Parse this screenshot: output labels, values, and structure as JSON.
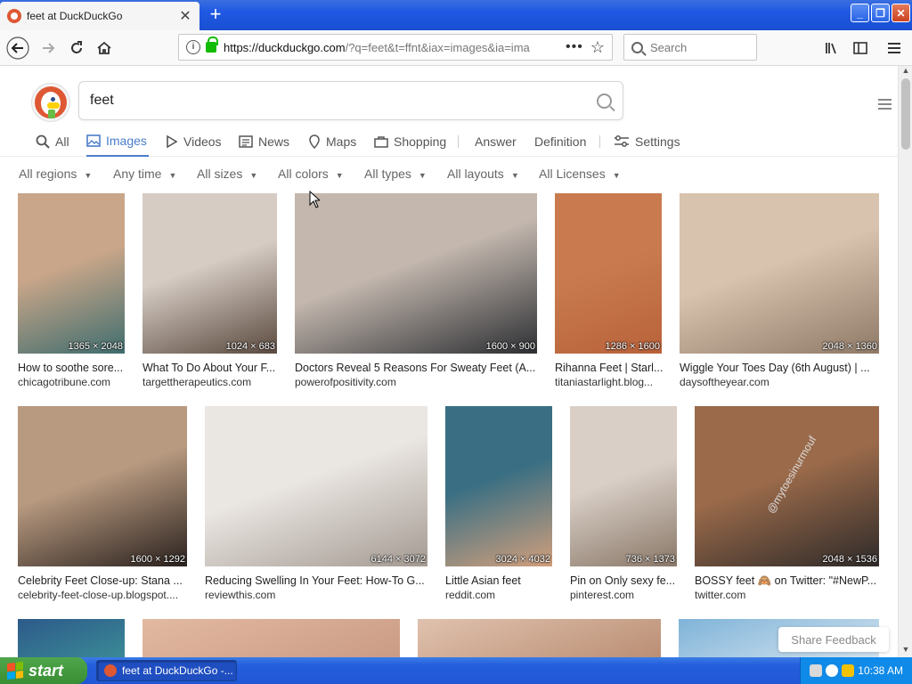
{
  "browser": {
    "tab_title": "feet at DuckDuckGo",
    "tab_close": "✕",
    "new_tab": "+",
    "url_host": "https://duckduckgo.com",
    "url_rest": "/?q=feet&t=ffnt&iax=images&ia=ima",
    "search_placeholder": "Search",
    "win_min": "_",
    "win_max": "❐",
    "win_close": "✕"
  },
  "ddg": {
    "query": "feet",
    "tabs": [
      {
        "label": "All"
      },
      {
        "label": "Images"
      },
      {
        "label": "Videos"
      },
      {
        "label": "News"
      },
      {
        "label": "Maps"
      },
      {
        "label": "Shopping"
      },
      {
        "label": "Answer"
      },
      {
        "label": "Definition"
      },
      {
        "label": "Settings"
      }
    ],
    "filters": [
      {
        "label": "All regions"
      },
      {
        "label": "Any time"
      },
      {
        "label": "All sizes"
      },
      {
        "label": "All colors"
      },
      {
        "label": "All types"
      },
      {
        "label": "All layouts"
      },
      {
        "label": "All Licenses"
      }
    ],
    "results": [
      {
        "title": "How to soothe sore...",
        "source": "chicagotribune.com",
        "dims": "1365 × 2048",
        "c1": "#c9a689",
        "c2": "#3f6d6e"
      },
      {
        "title": "What To Do About Your F...",
        "source": "targettherapeutics.com",
        "dims": "1024 × 683",
        "c1": "#d6ccc4",
        "c2": "#5b4a3f"
      },
      {
        "title": "Doctors Reveal 5 Reasons For Sweaty Feet (A...",
        "source": "powerofpositivity.com",
        "dims": "1600 × 900",
        "c1": "#c3b7ae",
        "c2": "#2d2f33"
      },
      {
        "title": "Rihanna Feet | Starl...",
        "source": "titaniastarlight.blog...",
        "dims": "1286 × 1600",
        "c1": "#c97b4f",
        "c2": "#b9623a"
      },
      {
        "title": "Wiggle Your Toes Day (6th August) | ...",
        "source": "daysoftheyear.com",
        "dims": "2048 × 1360",
        "c1": "#d8c3ae",
        "c2": "#8f7a68"
      },
      {
        "title": "Celebrity Feet Close-up: Stana ...",
        "source": "celebrity-feet-close-up.blogspot....",
        "dims": "1600 × 1292",
        "c1": "#b89a80",
        "c2": "#2a211e"
      },
      {
        "title": "Reducing Swelling In Your Feet: How-To G...",
        "source": "reviewthis.com",
        "dims": "6144 × 3072",
        "c1": "#eae6e2",
        "c2": "#a49a92"
      },
      {
        "title": "Little Asian feet",
        "source": "reddit.com",
        "dims": "3024 × 4032",
        "c1": "#3a6f83",
        "c2": "#d19f7c"
      },
      {
        "title": "Pin on Only sexy fe...",
        "source": "pinterest.com",
        "dims": "736 × 1373",
        "c1": "#d9cfc7",
        "c2": "#8a7868"
      },
      {
        "title": "BOSSY feet 🙈 on Twitter: \"#NewP...",
        "source": "twitter.com",
        "dims": "2048 × 1536",
        "c1": "#9a6a4a",
        "c2": "#2e2a29"
      }
    ],
    "row3": [
      {
        "c1": "#2d5a8a",
        "c2": "#3b8d97"
      },
      {
        "c1": "#e3b9a2",
        "c2": "#c99a83"
      },
      {
        "c1": "#e0c2ae",
        "c2": "#b98c72"
      },
      {
        "c1": "#7fb3d8",
        "c2": "#d7e6f1"
      }
    ],
    "watermark": "@mytoesinurmouf",
    "feedback": "Share Feedback"
  },
  "taskbar": {
    "start": "start",
    "item": "feet at DuckDuckGo -...",
    "clock": "10:38 AM"
  }
}
